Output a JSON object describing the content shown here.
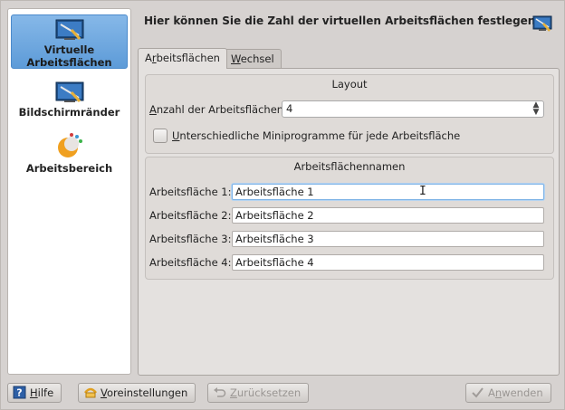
{
  "header": {
    "title": "Hier können Sie die Zahl der virtuellen Arbeitsflächen festlegen"
  },
  "sidebar": {
    "items": [
      {
        "line1": "Virtuelle",
        "line2": "Arbeitsflächen",
        "selected": true,
        "icon": "virtual-desktops-icon"
      },
      {
        "line1": "Bildschirmränder",
        "icon": "screen-edges-icon"
      },
      {
        "line1": "Arbeitsbereich",
        "icon": "workspace-icon"
      }
    ]
  },
  "tabs": [
    {
      "pre": "A",
      "ul": "r",
      "post": "beitsflächen",
      "active": true
    },
    {
      "pre": "",
      "ul": "W",
      "post": "echsel",
      "active": false
    }
  ],
  "layout": {
    "title": "Layout",
    "count_label_ul": "A",
    "count_label_rest": "nzahl der Arbeitsflächen:",
    "count_value": "4",
    "checkbox_ul": "U",
    "checkbox_rest": "nterschiedliche Miniprogramme für jede Arbeitsfläche",
    "checkbox_checked": false
  },
  "names": {
    "title": "Arbeitsflächennamen",
    "rows": [
      {
        "label": "Arbeitsfläche 1:",
        "value": "Arbeitsfläche 1"
      },
      {
        "label": "Arbeitsfläche 2:",
        "value": "Arbeitsfläche 2"
      },
      {
        "label": "Arbeitsfläche 3:",
        "value": "Arbeitsfläche 3"
      },
      {
        "label": "Arbeitsfläche 4:",
        "value": "Arbeitsfläche 4"
      }
    ]
  },
  "buttons": {
    "help": {
      "ul": "H",
      "rest": "ilfe",
      "icon": "help-icon"
    },
    "defaults": {
      "ul": "V",
      "rest": "oreinstellungen",
      "icon": "defaults-icon"
    },
    "reset": {
      "ul": "Z",
      "rest": "urücksetzen",
      "icon": "undo-icon",
      "enabled": false
    },
    "apply": {
      "pre": "A",
      "ul": "n",
      "rest": "wenden",
      "icon": "check-icon",
      "enabled": false
    }
  },
  "colors": {
    "selection": "#5d9bd8",
    "focus": "#7fb3e6",
    "window_bg": "#d6d2d0"
  }
}
